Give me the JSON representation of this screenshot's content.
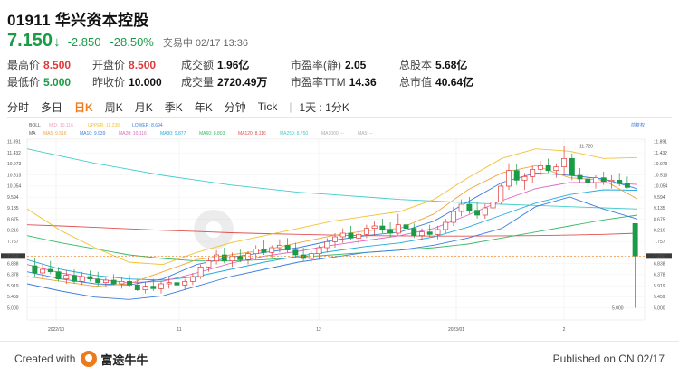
{
  "stock": {
    "code_name": "01911 华兴资本控股",
    "price": "7.150",
    "change": "-2.850",
    "change_pct": "-28.50%",
    "status": "交易中 02/17 13:36"
  },
  "stats": [
    [
      {
        "label": "最高价",
        "value": "8.500",
        "tone": "red"
      },
      {
        "label": "开盘价",
        "value": "8.500",
        "tone": "red"
      },
      {
        "label": "成交额",
        "value": "1.96亿",
        "tone": ""
      },
      {
        "label": "市盈率(静)",
        "value": "2.05",
        "tone": ""
      },
      {
        "label": "总股本",
        "value": "5.68亿",
        "tone": ""
      }
    ],
    [
      {
        "label": "最低价",
        "value": "5.000",
        "tone": "green"
      },
      {
        "label": "昨收价",
        "value": "10.000",
        "tone": ""
      },
      {
        "label": "成交量",
        "value": "2720.49万",
        "tone": ""
      },
      {
        "label": "市盈率TTM",
        "value": "14.36",
        "tone": ""
      },
      {
        "label": "总市值",
        "value": "40.64亿",
        "tone": ""
      }
    ]
  ],
  "tabs": [
    "分时",
    "多日",
    "日K",
    "周K",
    "月K",
    "季K",
    "年K",
    "分钟",
    "Tick"
  ],
  "active_tab": "日K",
  "interval_label": "1天 : 1分K",
  "legend": {
    "row1": [
      {
        "text": "BOLL",
        "color": "#555555"
      },
      {
        "text": "MID: 10.116",
        "color": "#f0a0c0"
      },
      {
        "text": "UPPER: 11.238",
        "color": "#f2c230"
      },
      {
        "text": "LOWER: 8.694",
        "color": "#3b7de0"
      }
    ],
    "row2": [
      {
        "text": "MA",
        "color": "#555555"
      },
      {
        "text": "MA5: 9.516",
        "color": "#f2a33a"
      },
      {
        "text": "MA10: 9.939",
        "color": "#3b7de0"
      },
      {
        "text": "MA20: 10.116",
        "color": "#e066c0"
      },
      {
        "text": "MA30: 9.877",
        "color": "#22aadd"
      },
      {
        "text": "MA60: 8.803",
        "color": "#33bb66"
      },
      {
        "text": "MA120: 8.116",
        "color": "#e05050"
      },
      {
        "text": "MA250: 8.750",
        "color": "#44cccc"
      },
      {
        "text": "MA1000: --",
        "color": "#aaaaaa"
      },
      {
        "text": "MA5: --",
        "color": "#aaaaaa"
      }
    ],
    "adjust_label": "前复权"
  },
  "chart_data": {
    "type": "candlestick",
    "ylim": [
      4.5,
      12.0
    ],
    "y_ticks": [
      "11.891",
      "11.432",
      "10.973",
      "10.513",
      "10.054",
      "9.594",
      "9.135",
      "8.675",
      "8.216",
      "7.757",
      "7.150",
      "6.838",
      "6.378",
      "5.919",
      "5.459",
      "5.000"
    ],
    "x_labels": [
      "2022/10",
      "11",
      "12",
      "2023/01",
      "2"
    ],
    "annotations": {
      "high": "11.720",
      "low": "5.000"
    },
    "last_price": 7.15,
    "prev_close": 7.15,
    "colors": {
      "up": "#e0393a",
      "down": "#1a9b46"
    },
    "candles": [
      {
        "o": 6.75,
        "h": 7.05,
        "l": 6.3,
        "c": 6.45
      },
      {
        "o": 6.45,
        "h": 6.8,
        "l": 6.2,
        "c": 6.6
      },
      {
        "o": 6.6,
        "h": 6.95,
        "l": 6.4,
        "c": 6.5
      },
      {
        "o": 6.5,
        "h": 6.7,
        "l": 6.1,
        "c": 6.2
      },
      {
        "o": 6.2,
        "h": 6.55,
        "l": 6.0,
        "c": 6.35
      },
      {
        "o": 6.35,
        "h": 6.6,
        "l": 6.0,
        "c": 6.1
      },
      {
        "o": 6.1,
        "h": 6.5,
        "l": 5.95,
        "c": 6.3
      },
      {
        "o": 6.3,
        "h": 6.55,
        "l": 6.1,
        "c": 6.2
      },
      {
        "o": 6.2,
        "h": 6.5,
        "l": 5.9,
        "c": 6.05
      },
      {
        "o": 6.05,
        "h": 6.3,
        "l": 5.85,
        "c": 6.15
      },
      {
        "o": 6.15,
        "h": 6.4,
        "l": 5.95,
        "c": 6.0
      },
      {
        "o": 6.0,
        "h": 6.3,
        "l": 5.8,
        "c": 6.1
      },
      {
        "o": 6.1,
        "h": 6.35,
        "l": 5.85,
        "c": 5.95
      },
      {
        "o": 5.95,
        "h": 6.2,
        "l": 5.7,
        "c": 5.75
      },
      {
        "o": 5.75,
        "h": 6.1,
        "l": 5.6,
        "c": 5.9
      },
      {
        "o": 5.9,
        "h": 6.2,
        "l": 5.7,
        "c": 5.8
      },
      {
        "o": 5.8,
        "h": 6.1,
        "l": 5.6,
        "c": 6.0
      },
      {
        "o": 6.0,
        "h": 6.3,
        "l": 5.8,
        "c": 6.05
      },
      {
        "o": 6.05,
        "h": 6.4,
        "l": 5.9,
        "c": 5.95
      },
      {
        "o": 5.95,
        "h": 6.2,
        "l": 5.75,
        "c": 6.1
      },
      {
        "o": 6.1,
        "h": 6.45,
        "l": 5.95,
        "c": 6.3
      },
      {
        "o": 6.3,
        "h": 6.8,
        "l": 6.2,
        "c": 6.7
      },
      {
        "o": 6.7,
        "h": 7.1,
        "l": 6.5,
        "c": 6.95
      },
      {
        "o": 6.95,
        "h": 7.4,
        "l": 6.8,
        "c": 7.2
      },
      {
        "o": 7.2,
        "h": 7.5,
        "l": 6.85,
        "c": 6.95
      },
      {
        "o": 6.95,
        "h": 7.3,
        "l": 6.7,
        "c": 7.15
      },
      {
        "o": 7.15,
        "h": 7.45,
        "l": 6.9,
        "c": 7.0
      },
      {
        "o": 7.0,
        "h": 7.35,
        "l": 6.8,
        "c": 7.25
      },
      {
        "o": 7.25,
        "h": 7.6,
        "l": 7.0,
        "c": 7.45
      },
      {
        "o": 7.45,
        "h": 7.8,
        "l": 7.2,
        "c": 7.3
      },
      {
        "o": 7.3,
        "h": 7.6,
        "l": 7.05,
        "c": 7.5
      },
      {
        "o": 7.5,
        "h": 7.85,
        "l": 7.3,
        "c": 7.6
      },
      {
        "o": 7.6,
        "h": 7.9,
        "l": 7.3,
        "c": 7.4
      },
      {
        "o": 7.4,
        "h": 7.7,
        "l": 7.1,
        "c": 7.2
      },
      {
        "o": 7.2,
        "h": 7.5,
        "l": 6.95,
        "c": 7.05
      },
      {
        "o": 7.05,
        "h": 7.35,
        "l": 6.9,
        "c": 7.25
      },
      {
        "o": 7.25,
        "h": 7.6,
        "l": 7.0,
        "c": 7.5
      },
      {
        "o": 7.5,
        "h": 7.9,
        "l": 7.3,
        "c": 7.75
      },
      {
        "o": 7.75,
        "h": 8.1,
        "l": 7.5,
        "c": 7.95
      },
      {
        "o": 7.95,
        "h": 8.3,
        "l": 7.7,
        "c": 8.1
      },
      {
        "o": 8.1,
        "h": 8.4,
        "l": 7.8,
        "c": 7.9
      },
      {
        "o": 7.9,
        "h": 8.2,
        "l": 7.65,
        "c": 8.05
      },
      {
        "o": 8.05,
        "h": 8.45,
        "l": 7.9,
        "c": 8.3
      },
      {
        "o": 8.3,
        "h": 8.6,
        "l": 8.0,
        "c": 8.4
      },
      {
        "o": 8.4,
        "h": 8.7,
        "l": 8.1,
        "c": 8.25
      },
      {
        "o": 8.25,
        "h": 8.55,
        "l": 7.95,
        "c": 8.1
      },
      {
        "o": 8.1,
        "h": 8.9,
        "l": 8.0,
        "c": 8.45
      },
      {
        "o": 8.45,
        "h": 8.8,
        "l": 8.2,
        "c": 8.3
      },
      {
        "o": 8.3,
        "h": 8.5,
        "l": 7.9,
        "c": 8.0
      },
      {
        "o": 8.0,
        "h": 8.3,
        "l": 7.8,
        "c": 8.15
      },
      {
        "o": 8.15,
        "h": 8.45,
        "l": 7.95,
        "c": 8.05
      },
      {
        "o": 8.05,
        "h": 8.4,
        "l": 7.85,
        "c": 8.25
      },
      {
        "o": 8.25,
        "h": 8.7,
        "l": 8.1,
        "c": 8.55
      },
      {
        "o": 8.55,
        "h": 9.2,
        "l": 8.4,
        "c": 9.0
      },
      {
        "o": 9.0,
        "h": 9.5,
        "l": 8.8,
        "c": 9.3
      },
      {
        "o": 9.3,
        "h": 9.6,
        "l": 8.9,
        "c": 9.05
      },
      {
        "o": 9.05,
        "h": 9.4,
        "l": 8.7,
        "c": 8.85
      },
      {
        "o": 8.85,
        "h": 9.3,
        "l": 8.7,
        "c": 9.15
      },
      {
        "o": 9.15,
        "h": 9.55,
        "l": 8.95,
        "c": 9.4
      },
      {
        "o": 9.4,
        "h": 10.2,
        "l": 9.3,
        "c": 10.05
      },
      {
        "o": 10.05,
        "h": 11.0,
        "l": 9.9,
        "c": 10.7
      },
      {
        "o": 10.7,
        "h": 10.95,
        "l": 10.1,
        "c": 10.3
      },
      {
        "o": 10.3,
        "h": 10.6,
        "l": 9.9,
        "c": 10.45
      },
      {
        "o": 10.45,
        "h": 10.9,
        "l": 10.2,
        "c": 10.75
      },
      {
        "o": 10.75,
        "h": 11.1,
        "l": 10.5,
        "c": 10.9
      },
      {
        "o": 10.9,
        "h": 11.2,
        "l": 10.6,
        "c": 10.7
      },
      {
        "o": 10.7,
        "h": 11.0,
        "l": 10.4,
        "c": 10.85
      },
      {
        "o": 10.85,
        "h": 11.72,
        "l": 10.5,
        "c": 11.2
      },
      {
        "o": 11.2,
        "h": 11.4,
        "l": 10.3,
        "c": 10.5
      },
      {
        "o": 10.5,
        "h": 10.8,
        "l": 10.2,
        "c": 10.35
      },
      {
        "o": 10.35,
        "h": 10.6,
        "l": 10.0,
        "c": 10.2
      },
      {
        "o": 10.2,
        "h": 10.5,
        "l": 9.95,
        "c": 10.4
      },
      {
        "o": 10.4,
        "h": 10.65,
        "l": 10.1,
        "c": 10.25
      },
      {
        "o": 10.25,
        "h": 10.5,
        "l": 9.95,
        "c": 10.3
      },
      {
        "o": 10.3,
        "h": 10.6,
        "l": 10.05,
        "c": 10.15
      },
      {
        "o": 10.15,
        "h": 10.45,
        "l": 9.95,
        "c": 10.0
      },
      {
        "o": 8.5,
        "h": 8.5,
        "l": 5.0,
        "c": 7.15
      }
    ],
    "ma_lines": [
      {
        "name": "MA250",
        "color": "#44cccc",
        "values": [
          11.6,
          11.3,
          11.0,
          10.75,
          10.5,
          10.3,
          10.1,
          9.95,
          9.8,
          9.7,
          9.6,
          9.5,
          9.43,
          9.36,
          9.3,
          9.25,
          9.2,
          9.15,
          9.1
        ]
      },
      {
        "name": "MA120",
        "color": "#e05050",
        "values": [
          8.45,
          8.4,
          8.34,
          8.28,
          8.22,
          8.17,
          8.12,
          8.08,
          8.05,
          8.02,
          8.0,
          7.99,
          7.98,
          7.98,
          7.99,
          8.0,
          8.02,
          8.05,
          8.1
        ]
      },
      {
        "name": "MA60",
        "color": "#33bb66",
        "values": [
          8.0,
          7.7,
          7.45,
          7.2,
          7.05,
          6.95,
          6.95,
          7.0,
          7.1,
          7.2,
          7.3,
          7.4,
          7.5,
          7.65,
          7.9,
          8.15,
          8.4,
          8.65,
          8.85
        ]
      },
      {
        "name": "MA30",
        "color": "#22aadd",
        "values": [
          7.0,
          6.6,
          6.35,
          6.2,
          6.15,
          6.3,
          6.6,
          6.9,
          7.15,
          7.35,
          7.55,
          7.7,
          7.95,
          8.35,
          8.85,
          9.35,
          9.7,
          9.9,
          9.88
        ]
      },
      {
        "name": "MA20",
        "color": "#e066c0",
        "values": [
          6.8,
          6.45,
          6.2,
          6.05,
          6.1,
          6.45,
          6.85,
          7.15,
          7.35,
          7.6,
          7.8,
          8.0,
          8.3,
          8.85,
          9.45,
          9.95,
          10.2,
          10.2,
          10.12
        ]
      },
      {
        "name": "MA10",
        "color": "#3b7de0",
        "values": [
          6.5,
          6.2,
          6.0,
          5.95,
          6.2,
          6.8,
          7.1,
          7.3,
          7.5,
          7.8,
          8.0,
          8.15,
          8.6,
          9.4,
          10.2,
          10.6,
          10.5,
          10.35,
          9.94
        ]
      },
      {
        "name": "MA5",
        "color": "#f2a33a",
        "values": [
          6.3,
          6.1,
          5.9,
          6.0,
          6.5,
          7.0,
          7.2,
          7.4,
          7.7,
          8.0,
          8.2,
          8.3,
          8.9,
          9.9,
          10.6,
          10.9,
          10.4,
          10.3,
          9.52
        ]
      },
      {
        "name": "UPPER",
        "color": "#f2c230",
        "values": [
          9.1,
          8.2,
          7.5,
          6.9,
          6.8,
          7.3,
          7.7,
          8.0,
          8.3,
          8.6,
          8.8,
          9.0,
          9.5,
          10.4,
          11.2,
          11.6,
          11.5,
          11.2,
          11.24
        ]
      },
      {
        "name": "LOWER",
        "color": "#3b7de0",
        "values": [
          6.0,
          5.7,
          5.45,
          5.35,
          5.5,
          5.9,
          6.3,
          6.6,
          6.9,
          7.1,
          7.3,
          7.4,
          7.6,
          7.9,
          8.3,
          9.2,
          9.6,
          9.1,
          8.69
        ]
      }
    ]
  },
  "footer": {
    "created_with": "Created with",
    "brand": "富途牛牛",
    "published": "Published on CN 02/17"
  }
}
